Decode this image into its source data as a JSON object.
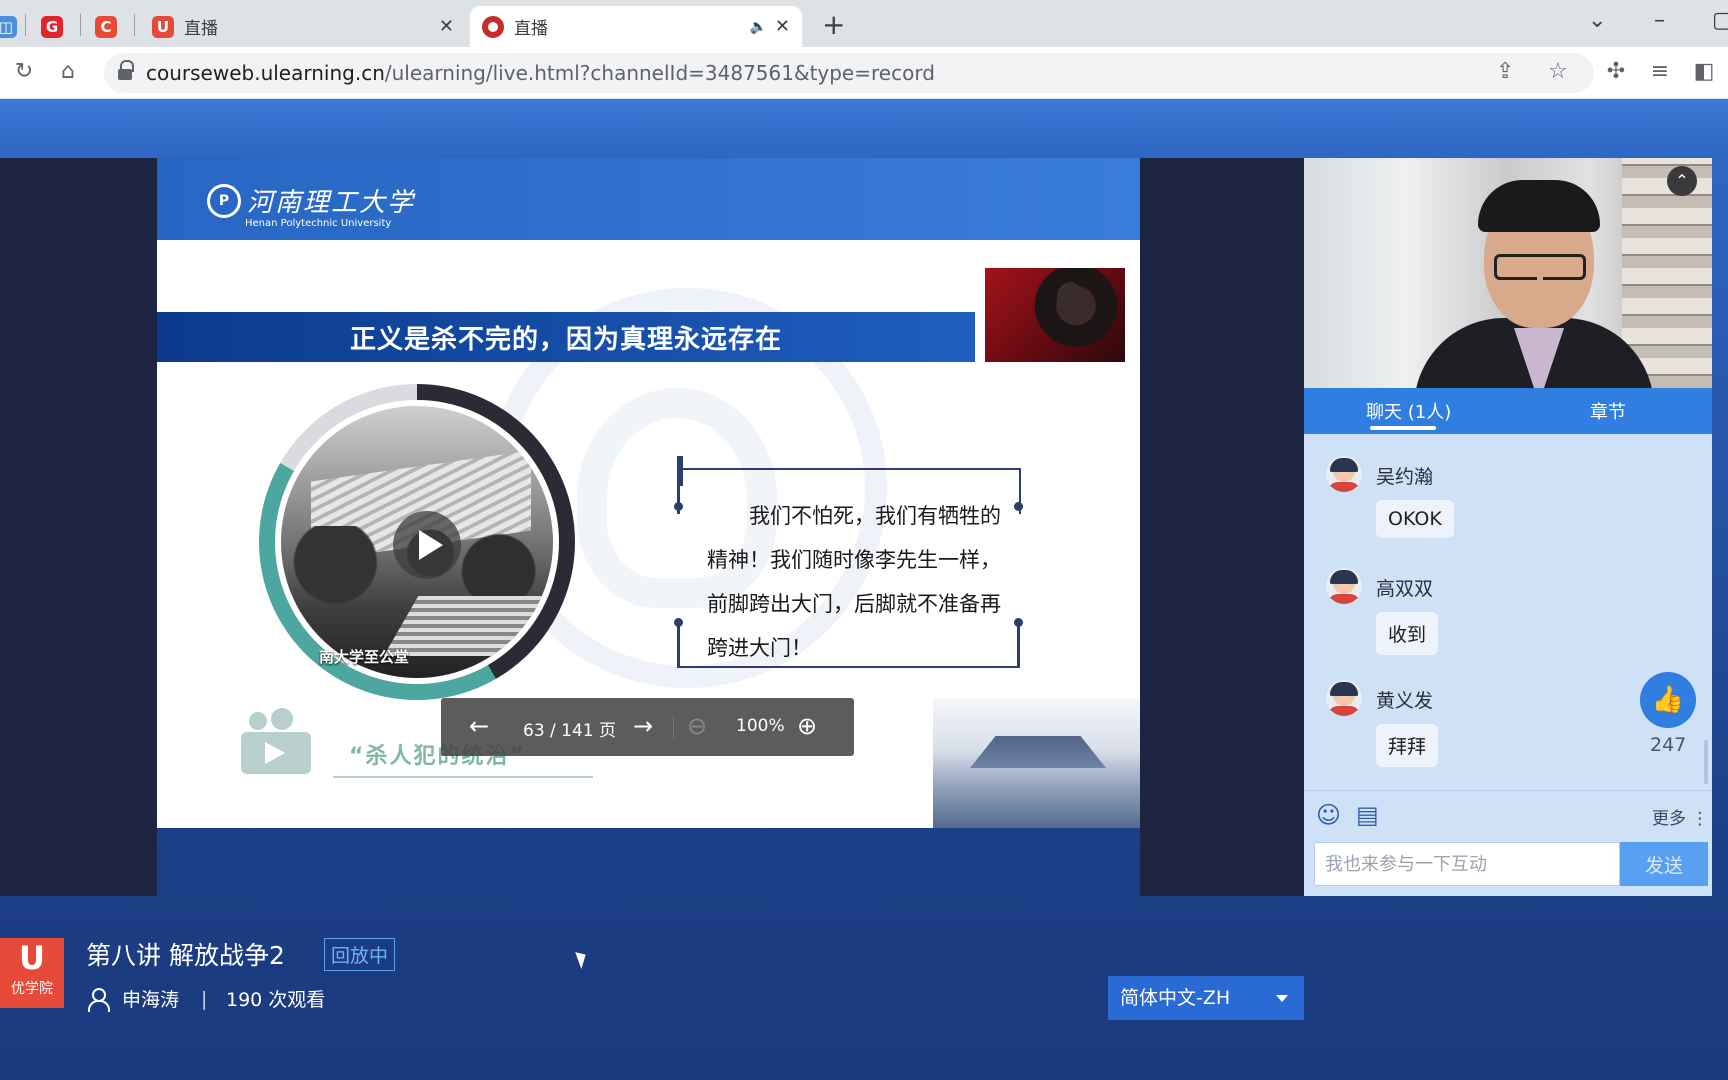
{
  "browser": {
    "tabs": [
      {
        "title": "直播",
        "active": false
      },
      {
        "title": "直播",
        "active": true
      }
    ],
    "url_host": "courseweb.ulearning.cn",
    "url_path": "/ulearning/live.html?channelId=3487561&type=record"
  },
  "slide": {
    "logo_cn": "河南理工大学",
    "logo_en": "Henan Polytechnic University",
    "banner_text": "正义是杀不完的，因为真理永远存在",
    "photo_caption": "南大学至公堂",
    "quote": "我们不怕死，我们有牺牲的精神！我们随时像李先生一样，前脚跨出大门，后脚就不准备再跨进大门！",
    "section_title": "“杀人犯的统治”"
  },
  "controls": {
    "page_info": "63 / 141 页",
    "zoom": "100%"
  },
  "panel": {
    "tab_chat": "聊天 (1人)",
    "tab_chapters": "章节",
    "messages": [
      {
        "name": "吴约瀚",
        "text": "OKOK"
      },
      {
        "name": "高双双",
        "text": "收到"
      },
      {
        "name": "黄义发",
        "text": "拜拜"
      }
    ],
    "likes": "247",
    "more_label": "更多",
    "input_placeholder": "我也来参与一下互动",
    "send_label": "发送"
  },
  "lesson": {
    "logo_text": "优学院",
    "title": "第八讲 解放战争2",
    "status": "回放中",
    "teacher": "申海涛",
    "divider": "|",
    "views": "190 次观看",
    "language": "简体中文-ZH"
  }
}
